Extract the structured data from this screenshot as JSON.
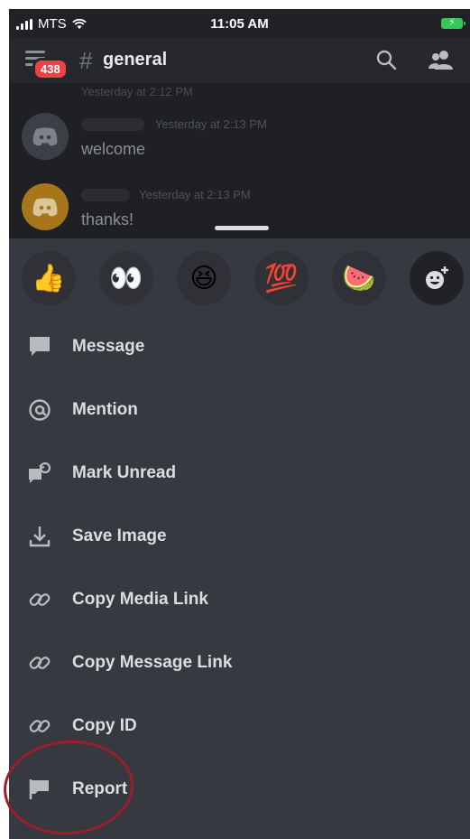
{
  "status_bar": {
    "carrier": "MTS",
    "time": "11:05 AM"
  },
  "header": {
    "badge": "438",
    "hash": "#",
    "channel": "general"
  },
  "chat": {
    "partial_timestamp": "Yesterday at 2:12 PM",
    "messages": [
      {
        "timestamp": "Yesterday at 2:13 PM",
        "text": "welcome",
        "avatar_color": "#3c3f45"
      },
      {
        "timestamp": "Yesterday at 2:13 PM",
        "text": "thanks!",
        "avatar_color": "#a8761a"
      }
    ]
  },
  "reactions": [
    {
      "emoji": "👍",
      "icon": "thumbs-up-icon"
    },
    {
      "emoji": "👀",
      "icon": "eyes-icon"
    },
    {
      "emoji": "😆",
      "icon": "laughing-face-icon"
    },
    {
      "emoji": "💯",
      "icon": "hundred-points-icon"
    },
    {
      "emoji": "🍉",
      "icon": "watermelon-icon"
    }
  ],
  "menu": [
    {
      "label": "Message",
      "icon": "chat-bubble-icon"
    },
    {
      "label": "Mention",
      "icon": "at-sign-icon"
    },
    {
      "label": "Mark Unread",
      "icon": "mark-unread-icon"
    },
    {
      "label": "Save Image",
      "icon": "download-icon"
    },
    {
      "label": "Copy Media Link",
      "icon": "link-icon"
    },
    {
      "label": "Copy Message Link",
      "icon": "link-icon"
    },
    {
      "label": "Copy ID",
      "icon": "link-icon"
    },
    {
      "label": "Report",
      "icon": "flag-icon"
    }
  ],
  "colors": {
    "background": "#202225",
    "sheet": "#36393f",
    "badge": "#ed4245",
    "annotation_circle": "#9b1e2c",
    "battery": "#35c759"
  }
}
